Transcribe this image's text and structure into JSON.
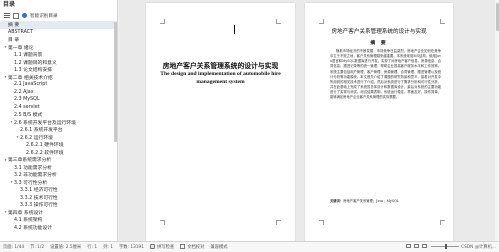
{
  "nav": {
    "title": "目录",
    "toolbar_label": "智能识别目录",
    "items": [
      {
        "label": "摘 要",
        "indent": 0,
        "toggle": ""
      },
      {
        "label": "ABSTRACT",
        "indent": 0,
        "toggle": ""
      },
      {
        "label": "目 录",
        "indent": 0,
        "toggle": ""
      },
      {
        "label": "第一章 绪论",
        "indent": 0,
        "toggle": "▾"
      },
      {
        "label": "1.1 课题背景",
        "indent": 1,
        "toggle": ""
      },
      {
        "label": "1.2 课题目的和意义",
        "indent": 1,
        "toggle": ""
      },
      {
        "label": "1.3 论文结构安排",
        "indent": 1,
        "toggle": ""
      },
      {
        "label": "第二章 相关技术介绍",
        "indent": 0,
        "toggle": "▾"
      },
      {
        "label": "2.1 JavaScript",
        "indent": 1,
        "toggle": ""
      },
      {
        "label": "2.2 Ajax",
        "indent": 1,
        "toggle": ""
      },
      {
        "label": "2.3 MySQL",
        "indent": 1,
        "toggle": ""
      },
      {
        "label": "2.4 servlet",
        "indent": 1,
        "toggle": ""
      },
      {
        "label": "2.5 B/S 模式",
        "indent": 1,
        "toggle": ""
      },
      {
        "label": "2.6 系统开发平台及运行环境",
        "indent": 1,
        "toggle": "▾"
      },
      {
        "label": "2.6.1 系统开发平台",
        "indent": 2,
        "toggle": ""
      },
      {
        "label": "2.6.2 运行环境",
        "indent": 2,
        "toggle": "▾"
      },
      {
        "label": "2.6.2.1 硬件环境",
        "indent": 3,
        "toggle": ""
      },
      {
        "label": "2.6.2.2 软件环境",
        "indent": 3,
        "toggle": ""
      },
      {
        "label": "第三章系统需求分析",
        "indent": 0,
        "toggle": "▾"
      },
      {
        "label": "3.1 功能需求分析",
        "indent": 1,
        "toggle": ""
      },
      {
        "label": "3.2 非功能需求分析",
        "indent": 1,
        "toggle": ""
      },
      {
        "label": "3.3 可行性分析",
        "indent": 1,
        "toggle": "▾"
      },
      {
        "label": "3.3.1 经济可行性",
        "indent": 2,
        "toggle": ""
      },
      {
        "label": "3.3.2 技术可行性",
        "indent": 2,
        "toggle": ""
      },
      {
        "label": "3.3.3 操作可行性",
        "indent": 2,
        "toggle": ""
      },
      {
        "label": "第四章 系统设计",
        "indent": 0,
        "toggle": "▾"
      },
      {
        "label": "4.1 系统架构",
        "indent": 1,
        "toggle": ""
      },
      {
        "label": "4.2 系统功能设计",
        "indent": 1,
        "toggle": ""
      }
    ]
  },
  "left_page": {
    "title_cn": "房地产客户关系管理系统的设计与实现",
    "title_en": "The design and implementation of automobile hire management system"
  },
  "right_page": {
    "title": "房地产客户关系管理系统的设计与实现",
    "subtitle": "摘 要",
    "body": "随着市场经济的不断发展，市场竞争日益激烈，房地产企业如何在竞争中立于不败之地，客户关系管理越来越重要。本系统采用B/S结构，使用Java语言和MySQL数据库进行开发，实现了对房地产客户信息、房源信息、合同信息、跟进记录等的统一管理，帮助企业提高客户服务水平和工作效率。系统主要包括用户管理、客户管理、房源管理、合同管理、跟进管理以及统计分析等功能模块。本文首先介绍了课题的研究背景和意义，接着对开发中所用到的相关技术进行了介绍，然后对系统进行了需求分析和可行性分析，并在此基础上完成了系统的总体设计和数据库设计，最后对系统的主要功能进行了实现与测试。测试结果表明，系统运行稳定，界面友好，操作简单，能够满足房地产企业客户关系管理的实际需要。",
    "keywords_label": "关键词：",
    "keywords": "房地产客户关系管理；Java；MySQL"
  },
  "status_bar": {
    "page": "页面: 1/44",
    "section": "节: 1/2",
    "position": "设置值: 2.5厘米",
    "row": "行: 1",
    "column": "列: 1",
    "word_count": "字数: 13191",
    "spell_check": "拼写检查",
    "doc_check": "文档校对",
    "compat": "兼容模式",
    "watermark": "CSDN @计算机..."
  }
}
